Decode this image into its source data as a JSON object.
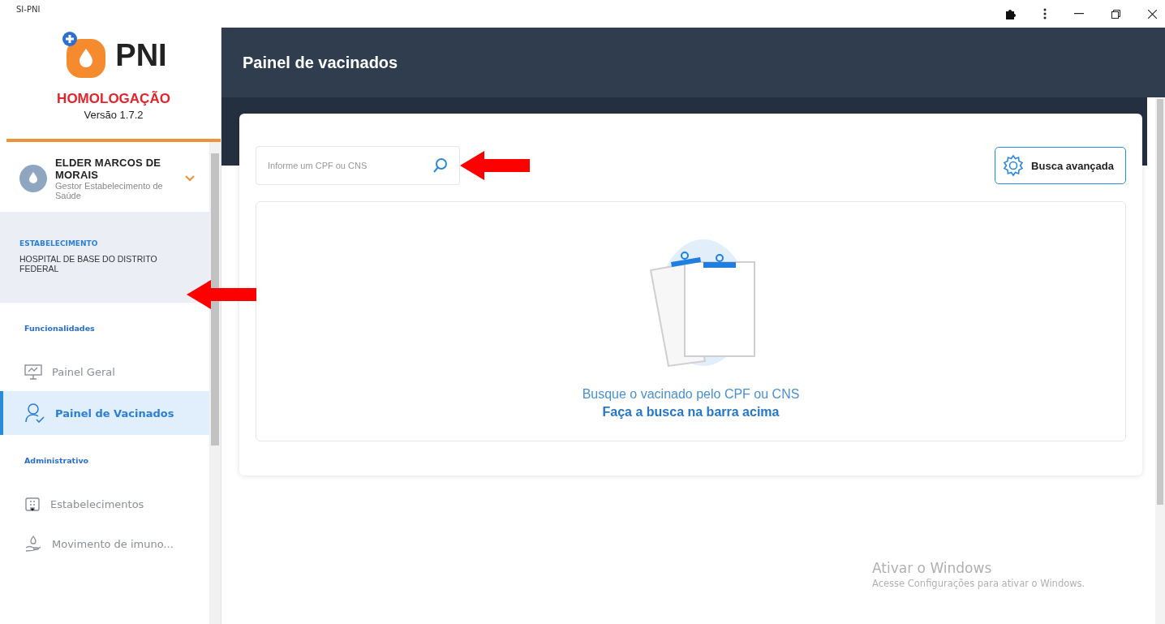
{
  "window": {
    "title": "SI-PNI"
  },
  "brand": {
    "logo_text": "PNI",
    "environment": "HOMOLOGAÇÃO",
    "version": "Versão 1.7.2"
  },
  "user": {
    "name": "ELDER MARCOS DE MORAIS",
    "role": "Gestor Estabelecimento de Saúde"
  },
  "establishment": {
    "label": "ESTABELECIMENTO",
    "value": "HOSPITAL DE BASE DO DISTRITO FEDERAL"
  },
  "nav": [
    {
      "title": "Funcionalidades",
      "items": [
        {
          "label": "Painel Geral",
          "selected": false
        },
        {
          "label": "Painel de Vacinados",
          "selected": true
        }
      ]
    },
    {
      "title": "Administrativo",
      "items": [
        {
          "label": "Estabelecimentos",
          "selected": false
        },
        {
          "label": "Movimento de imuno...",
          "selected": false
        }
      ]
    }
  ],
  "header": {
    "title": "Painel de vacinados"
  },
  "search": {
    "placeholder": "Informe um CPF ou CNS"
  },
  "advanced_button": {
    "label": "Busca avançada"
  },
  "empty_state": {
    "message": "Busque o vacinado pelo CPF ou CNS",
    "hint": "Faça a busca na barra acima"
  },
  "activation_notice": {
    "title": "Ativar o Windows",
    "text": "Acesse Configurações para ativar o Windows."
  }
}
